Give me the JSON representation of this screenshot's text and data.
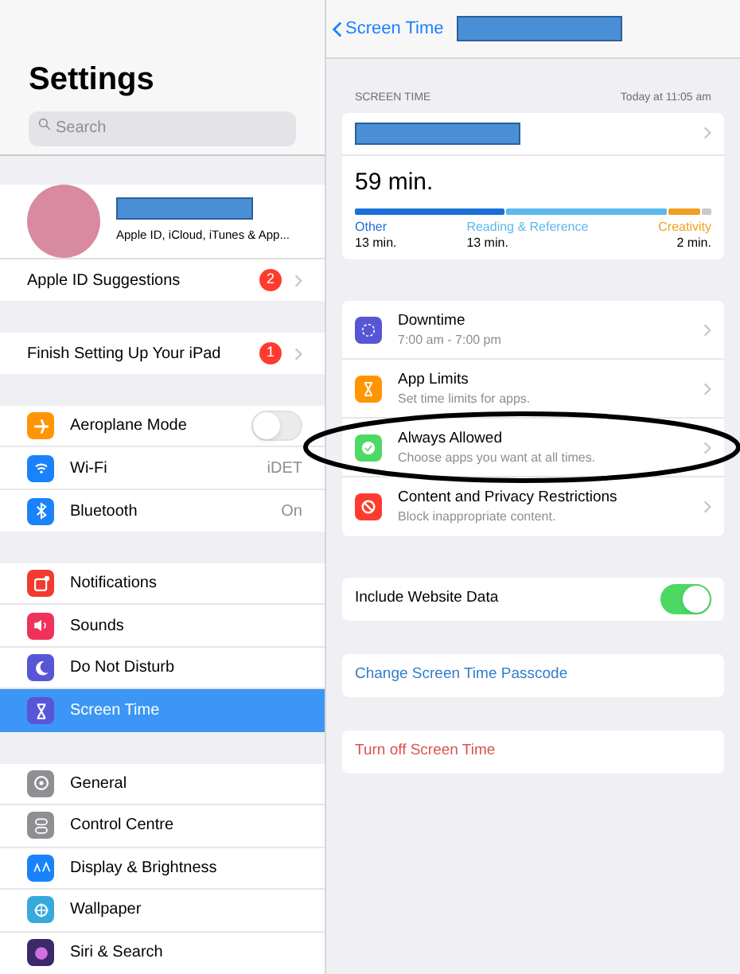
{
  "sidebar": {
    "title": "Settings",
    "search": {
      "placeholder": "Search"
    },
    "profile": {
      "subtitle": "Apple ID, iCloud, iTunes & App..."
    },
    "groups": [
      [
        {
          "kind": "badge",
          "label": "Apple ID Suggestions",
          "badge": "2",
          "selected": false
        }
      ],
      [
        {
          "kind": "badge",
          "label": "Finish Setting Up Your iPad",
          "badge": "1",
          "selected": false
        }
      ],
      [
        {
          "kind": "toggle",
          "label": "Aeroplane Mode",
          "on": false,
          "color": "#ff9500",
          "selected": false
        },
        {
          "kind": "value",
          "label": "Wi-Fi",
          "value": "iDET",
          "color": "#1a82fb",
          "selected": false
        },
        {
          "kind": "value",
          "label": "Bluetooth",
          "value": "On",
          "color": "#1a82fb",
          "selected": false
        }
      ],
      [
        {
          "kind": "plain",
          "label": "Notifications",
          "color": "#f23b30",
          "selected": false
        },
        {
          "kind": "plain",
          "label": "Sounds",
          "color": "#f0315a",
          "selected": false
        },
        {
          "kind": "plain",
          "label": "Do Not Disturb",
          "color": "#5856d6",
          "selected": false
        },
        {
          "kind": "plain",
          "label": "Screen Time",
          "color": "#5856d6",
          "selected": true
        }
      ],
      [
        {
          "kind": "plain",
          "label": "General",
          "color": "#8e8e93",
          "selected": false
        },
        {
          "kind": "plain",
          "label": "Control Centre",
          "color": "#8e8e93",
          "selected": false
        },
        {
          "kind": "plain",
          "label": "Display & Brightness",
          "color": "#1a82fb",
          "selected": false
        },
        {
          "kind": "plain",
          "label": "Wallpaper",
          "color": "#36aadc",
          "selected": false
        },
        {
          "kind": "plain",
          "label": "Siri & Search",
          "color": "#3a2a6a",
          "selected": false
        }
      ]
    ]
  },
  "detail": {
    "back": "Screen Time",
    "header": {
      "label": "SCREEN TIME",
      "time": "Today at 11:05 am"
    },
    "total": "59 min.",
    "legend": [
      {
        "name": "Other",
        "value": "13 min.",
        "color": "#1a6fd8"
      },
      {
        "name": "Reading & Reference",
        "value": "13 min.",
        "color": "#5bb8ea"
      },
      {
        "name": "Creativity",
        "value": "2 min.",
        "color": "#f0a020"
      }
    ],
    "options": [
      {
        "title": "Downtime",
        "subtitle": "7:00 am - 7:00 pm",
        "color": "#5856d6"
      },
      {
        "title": "App Limits",
        "subtitle": "Set time limits for apps.",
        "color": "#ff9500"
      },
      {
        "title": "Always Allowed",
        "subtitle": "Choose apps you want at all times.",
        "color": "#4cd964"
      },
      {
        "title": "Content and Privacy Restrictions",
        "subtitle": "Block inappropriate content.",
        "color": "#ff3b30"
      }
    ],
    "website": {
      "label": "Include Website Data",
      "on": true
    },
    "passcode": "Change Screen Time Passcode",
    "turn_off": "Turn off Screen Time"
  }
}
